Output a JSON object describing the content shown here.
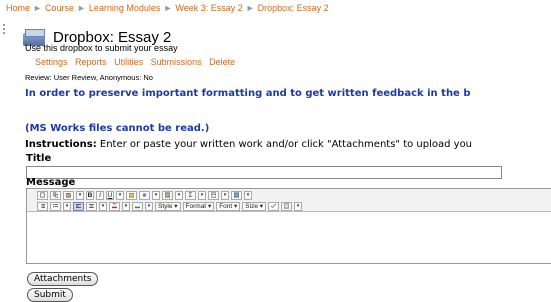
{
  "breadcrumb": [
    "Home",
    "Course",
    "Learning Modules",
    "Week 3: Essay 2",
    "Dropbox: Essay 2"
  ],
  "breadcrumb_sep": "►",
  "page": {
    "title": "Dropbox: Essay 2",
    "subtitle": "Use this dropbox to submit your essay"
  },
  "tabs": [
    "Settings",
    "Reports",
    "Utilities",
    "Submissions",
    "Delete"
  ],
  "review": "Review: User Review, Anonymous: No",
  "notice": "In order to preserve important formatting and to get written feedback in the b",
  "ms_works": "(MS Works files cannot be read.)",
  "instructions": {
    "label": "Instructions:",
    "text": " Enter or paste your written work and/or click \"Attachments\" to upload you"
  },
  "form": {
    "title_label": "Title",
    "title_value": "",
    "message_label": "Message"
  },
  "toolbar": {
    "bold": "B",
    "italic": "I",
    "underline": "U",
    "style": "Style",
    "format": "Format",
    "font": "Font",
    "size": "Size",
    "dropdown": "▾",
    "sigma": "Σ"
  },
  "buttons": {
    "attachments": "Attachments",
    "submit": "Submit"
  },
  "colors": {
    "link": "#d2691e",
    "notice": "#1a3aa8"
  }
}
